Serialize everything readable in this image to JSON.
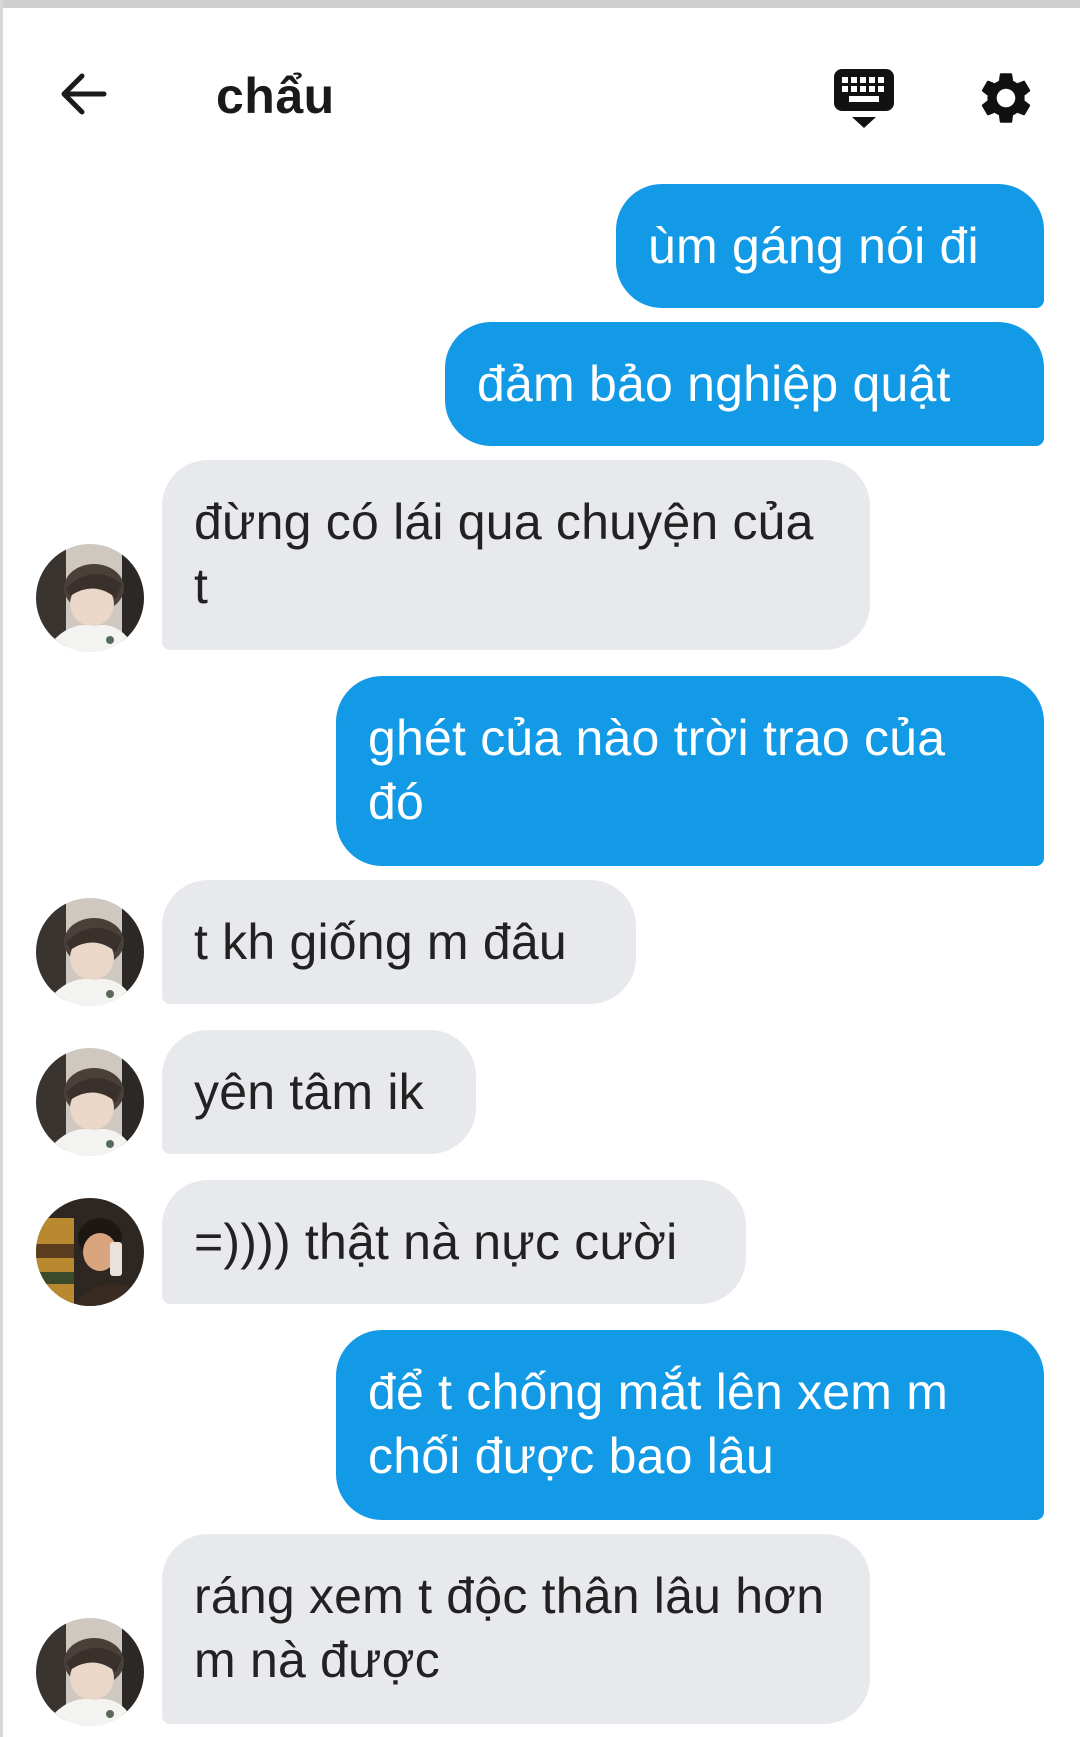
{
  "header": {
    "title": "chẩu",
    "back_icon": "arrow-left-icon",
    "keyboard_icon": "keyboard-icon",
    "settings_icon": "gear-icon"
  },
  "colors": {
    "outgoing_bubble": "#139ae6",
    "incoming_bubble": "#e7e9ec",
    "background": "#ffffff"
  },
  "messages": [
    {
      "direction": "outgoing",
      "text": "ùm gáng nói đi"
    },
    {
      "direction": "outgoing",
      "text": "đảm bảo nghiệp quật"
    },
    {
      "direction": "incoming",
      "text": "đừng có lái qua chuyện của t",
      "avatar": "avatar-a"
    },
    {
      "direction": "outgoing",
      "text": "ghét của nào trời trao của đó"
    },
    {
      "direction": "incoming",
      "text": "t kh giống m đâu",
      "avatar": "avatar-a"
    },
    {
      "direction": "incoming",
      "text": "yên tâm ik",
      "avatar": "avatar-a"
    },
    {
      "direction": "incoming",
      "text": "=)))) thật nà nực cười",
      "avatar": "avatar-b"
    },
    {
      "direction": "outgoing",
      "text": "để t chống mắt lên xem m chối được bao lâu"
    },
    {
      "direction": "incoming",
      "text": "ráng xem t độc thân lâu hơn m nà được",
      "avatar": "avatar-a"
    }
  ]
}
